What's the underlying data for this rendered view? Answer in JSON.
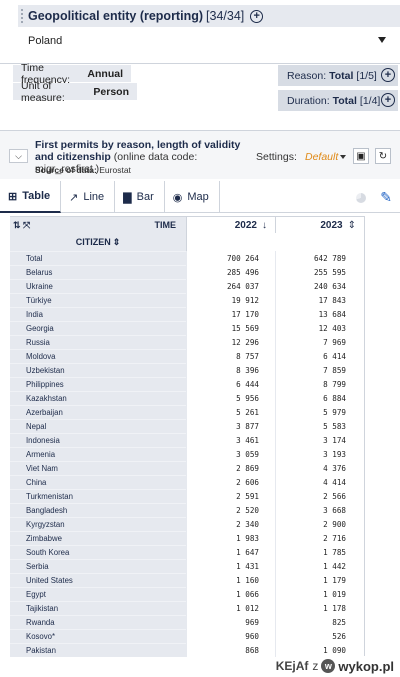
{
  "filters": {
    "geo": {
      "title": "Geopolitical entity (reporting)",
      "count": "[34/34]",
      "selected": "Poland"
    },
    "time_frequency": {
      "label": "Time frequency:",
      "value": "Annual"
    },
    "unit": {
      "label": "Unit of measure:",
      "value": "Person"
    },
    "reason": {
      "label": "Reason:",
      "value": "Total",
      "count": "[1/5]"
    },
    "duration": {
      "label": "Duration:",
      "value": "Total",
      "count": "[1/4]"
    }
  },
  "dataset": {
    "title": "First permits by reason, length of validity and citizenship",
    "code_text": "(online data code: migr_resfirst )",
    "source_label": "Source of data:",
    "source_value": "Eurostat",
    "settings_label": "Settings:",
    "settings_value": "Default"
  },
  "tabs": [
    {
      "label": "Table",
      "icon": "table-icon"
    },
    {
      "label": "Line",
      "icon": "line-chart-icon"
    },
    {
      "label": "Bar",
      "icon": "bar-chart-icon"
    },
    {
      "label": "Map",
      "icon": "map-pin-icon"
    }
  ],
  "table": {
    "time_label": "TIME",
    "citizen_label": "CITIZEN",
    "columns": [
      "2022",
      "2023"
    ],
    "rows": [
      {
        "label": "Total",
        "v2022": "700 264",
        "v2023": "642 789"
      },
      {
        "label": "Belarus",
        "v2022": "285 496",
        "v2023": "255 595"
      },
      {
        "label": "Ukraine",
        "v2022": "264 037",
        "v2023": "240 634"
      },
      {
        "label": "Türkiye",
        "v2022": "19 912",
        "v2023": "17 843"
      },
      {
        "label": "India",
        "v2022": "17 170",
        "v2023": "13 684"
      },
      {
        "label": "Georgia",
        "v2022": "15 569",
        "v2023": "12 403"
      },
      {
        "label": "Russia",
        "v2022": "12 296",
        "v2023": "7 969"
      },
      {
        "label": "Moldova",
        "v2022": "8 757",
        "v2023": "6 414"
      },
      {
        "label": "Uzbekistan",
        "v2022": "8 396",
        "v2023": "7 859"
      },
      {
        "label": "Philippines",
        "v2022": "6 444",
        "v2023": "8 799"
      },
      {
        "label": "Kazakhstan",
        "v2022": "5 956",
        "v2023": "6 884"
      },
      {
        "label": "Azerbaijan",
        "v2022": "5 261",
        "v2023": "5 979"
      },
      {
        "label": "Nepal",
        "v2022": "3 877",
        "v2023": "5 583"
      },
      {
        "label": "Indonesia",
        "v2022": "3 461",
        "v2023": "3 174"
      },
      {
        "label": "Armenia",
        "v2022": "3 059",
        "v2023": "3 193"
      },
      {
        "label": "Viet Nam",
        "v2022": "2 869",
        "v2023": "4 376"
      },
      {
        "label": "China",
        "v2022": "2 606",
        "v2023": "4 414"
      },
      {
        "label": "Turkmenistan",
        "v2022": "2 591",
        "v2023": "2 566"
      },
      {
        "label": "Bangladesh",
        "v2022": "2 520",
        "v2023": "3 668"
      },
      {
        "label": "Kyrgyzstan",
        "v2022": "2 340",
        "v2023": "2 900"
      },
      {
        "label": "Zimbabwe",
        "v2022": "1 983",
        "v2023": "2 716"
      },
      {
        "label": "South Korea",
        "v2022": "1 647",
        "v2023": "1 785"
      },
      {
        "label": "Serbia",
        "v2022": "1 431",
        "v2023": "1 442"
      },
      {
        "label": "United States",
        "v2022": "1 160",
        "v2023": "1 179"
      },
      {
        "label": "Egypt",
        "v2022": "1 066",
        "v2023": "1 019"
      },
      {
        "label": "Tajikistan",
        "v2022": "1 012",
        "v2023": "1 178"
      },
      {
        "label": "Rwanda",
        "v2022": "969",
        "v2023": "825"
      },
      {
        "label": "Kosovo*",
        "v2022": "960",
        "v2023": "526"
      },
      {
        "label": "Pakistan",
        "v2022": "868",
        "v2023": "1 090"
      }
    ]
  },
  "watermark": {
    "user": "KEjAf",
    "connector": "z",
    "brand": "wykop.pl"
  },
  "colors": {
    "accent_orange": "#e08a17",
    "navy": "#1d2b4a",
    "pencil_blue": "#1f62c4"
  }
}
